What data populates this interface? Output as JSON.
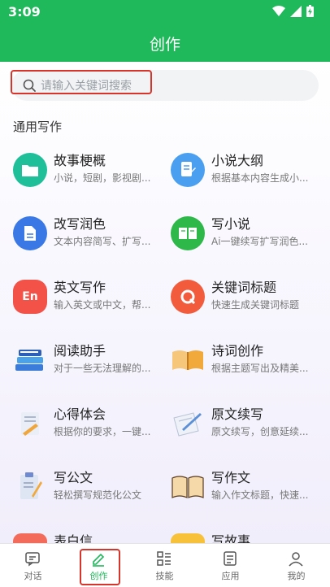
{
  "status_bar": {
    "time": "3:09"
  },
  "header": {
    "title": "创作"
  },
  "search": {
    "placeholder": "请输入关键词搜索"
  },
  "section": {
    "title": "通用写作"
  },
  "cards": [
    {
      "title": "故事梗概",
      "desc": "小说，短剧，影视剧...",
      "icon": "folder-icon",
      "color": "#1fbf9a"
    },
    {
      "title": "小说大纲",
      "desc": "根据基本内容生成小...",
      "icon": "document-edit-icon",
      "color": "#4a9ff0"
    },
    {
      "title": "改写润色",
      "desc": "文本内容简写、扩写...",
      "icon": "document-icon",
      "color": "#3a78e6"
    },
    {
      "title": "写小说",
      "desc": "Ai一键续写扩写润色...",
      "icon": "book-open-icon",
      "color": "#2fb84a"
    },
    {
      "title": "英文写作",
      "desc": "输入英文或中文，帮...",
      "icon": "en-chat-icon",
      "color": "#f25247"
    },
    {
      "title": "关键词标题",
      "desc": "快速生成关键词标题",
      "icon": "q-icon",
      "color": "#f25b3b"
    },
    {
      "title": "阅读助手",
      "desc": "对于一些无法理解的...",
      "icon": "books-stack-icon",
      "color": "#3b7bd9"
    },
    {
      "title": "诗词创作",
      "desc": "根据主题写出及精美...",
      "icon": "open-book-icon",
      "color": "#f2a93b"
    },
    {
      "title": "心得体会",
      "desc": "根据你的要求，一键...",
      "icon": "writing-pad-icon",
      "color": "#f0a63a"
    },
    {
      "title": "原文续写",
      "desc": "原文续写，创意延续...",
      "icon": "notebook-pen-icon",
      "color": "#5b8fd6"
    },
    {
      "title": "写公文",
      "desc": "轻松撰写规范化公文",
      "icon": "clipboard-pen-icon",
      "color": "#6f8ad1"
    },
    {
      "title": "写作文",
      "desc": "输入作文标题，快速...",
      "icon": "book-icon",
      "color": "#e08a3b"
    },
    {
      "title": "表白信",
      "desc": "",
      "icon": "heart-letter-icon",
      "color": "#f26b5b"
    },
    {
      "title": "写故事",
      "desc": "",
      "icon": "story-icon",
      "color": "#f7c23a"
    }
  ],
  "tabbar": {
    "items": [
      {
        "label": "对话",
        "icon": "chat-icon"
      },
      {
        "label": "创作",
        "icon": "pen-icon",
        "active": true
      },
      {
        "label": "技能",
        "icon": "skills-icon"
      },
      {
        "label": "应用",
        "icon": "apps-icon"
      },
      {
        "label": "我的",
        "icon": "profile-icon"
      }
    ]
  },
  "colors": {
    "primary": "#1fb85a",
    "highlight": "#d9342b"
  }
}
